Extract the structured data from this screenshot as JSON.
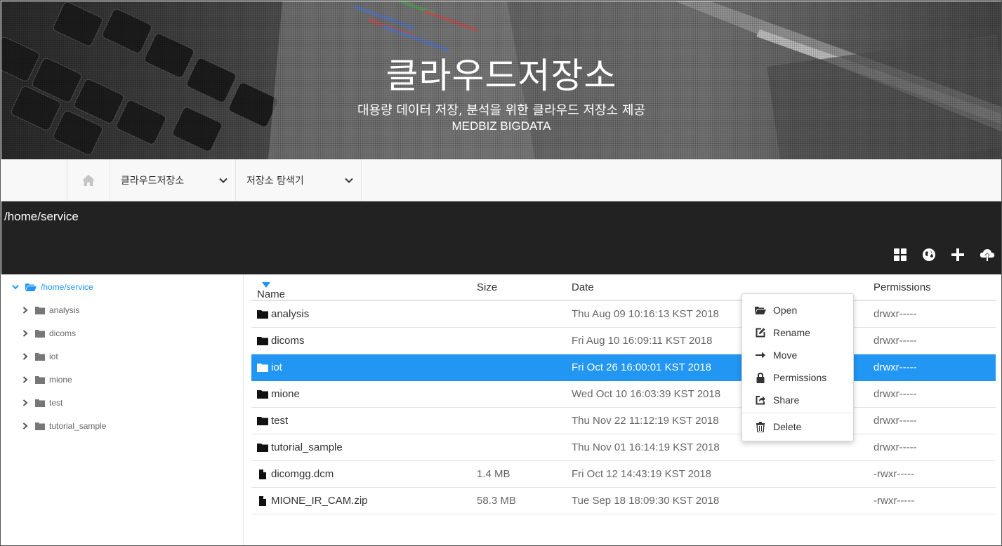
{
  "banner": {
    "title": "클라우드저장소",
    "subtitle": "대용량 데이터 저장, 분석을 위한 클라우드 저장소 제공",
    "brand": "MEDBIZ BIGDATA"
  },
  "nav": {
    "home_icon": "home-icon",
    "dropdown1": "클라우드저장소",
    "dropdown2": "저장소 탐색기"
  },
  "path": "/home/service",
  "toolbar": {
    "icons": [
      "grid-view-icon",
      "globe-icon",
      "plus-icon",
      "cloud-upload-icon"
    ]
  },
  "tree": {
    "root": "/home/service",
    "items": [
      "analysis",
      "dicoms",
      "iot",
      "mione",
      "test",
      "tutorial_sample"
    ]
  },
  "table": {
    "headers": {
      "name": "Name",
      "size": "Size",
      "date": "Date",
      "permissions": "Permissions"
    },
    "sort_indicator": "sort-desc-icon",
    "rows": [
      {
        "type": "folder",
        "name": "analysis",
        "size": "",
        "date": "Thu Aug 09 10:16:13 KST 2018",
        "perm": "drwxr-----"
      },
      {
        "type": "folder",
        "name": "dicoms",
        "size": "",
        "date": "Fri Aug 10 16:09:11 KST 2018",
        "perm": "drwxr-----"
      },
      {
        "type": "folder",
        "name": "iot",
        "size": "",
        "date": "Fri Oct 26 16:00:01 KST 2018",
        "perm": "drwxr-----",
        "selected": true
      },
      {
        "type": "folder",
        "name": "mione",
        "size": "",
        "date": "Wed Oct 10 16:03:39 KST 2018",
        "perm": "drwxr-----"
      },
      {
        "type": "folder",
        "name": "test",
        "size": "",
        "date": "Thu Nov 22 11:12:19 KST 2018",
        "perm": "drwxr-----"
      },
      {
        "type": "folder",
        "name": "tutorial_sample",
        "size": "",
        "date": "Thu Nov 01 16:14:19 KST 2018",
        "perm": "drwxr-----"
      },
      {
        "type": "file",
        "name": "dicomgg.dcm",
        "size": "1.4 MB",
        "date": "Fri Oct 12 14:43:19 KST 2018",
        "perm": "-rwxr-----"
      },
      {
        "type": "file",
        "name": "MIONE_IR_CAM.zip",
        "size": "58.3 MB",
        "date": "Tue Sep 18 18:09:30 KST 2018",
        "perm": "-rwxr-----"
      }
    ]
  },
  "context_menu": {
    "items": [
      {
        "label": "Open",
        "icon": "folder-open-icon"
      },
      {
        "label": "Rename",
        "icon": "edit-icon"
      },
      {
        "label": "Move",
        "icon": "arrow-right-icon"
      },
      {
        "label": "Permissions",
        "icon": "lock-icon"
      },
      {
        "label": "Share",
        "icon": "share-icon"
      },
      {
        "label": "Delete",
        "icon": "trash-icon"
      }
    ]
  },
  "colors": {
    "accent": "#2196f3",
    "pathbar": "#222222",
    "navbar": "#f8f8f8"
  }
}
